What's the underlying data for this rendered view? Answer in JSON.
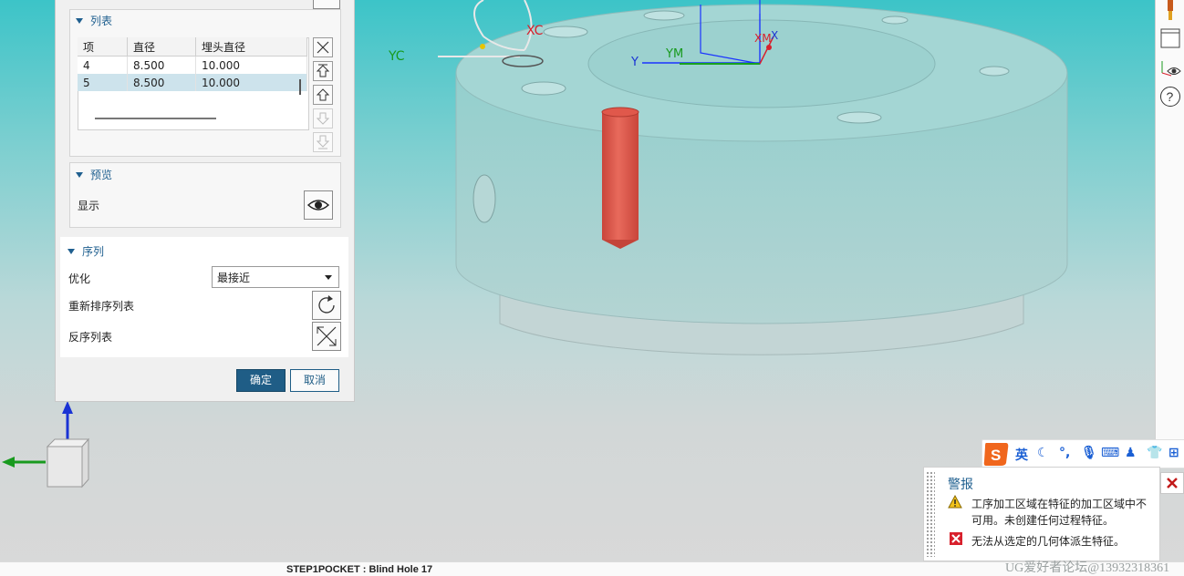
{
  "dialog": {
    "list_section": {
      "title": "列表",
      "columns": [
        "项",
        "直径",
        "埋头直径"
      ],
      "rows": [
        {
          "item": "4",
          "diameter": "8.500",
          "csink": "10.000"
        },
        {
          "item": "5",
          "diameter": "8.500",
          "csink": "10.000"
        }
      ],
      "selected_row_index": 1
    },
    "preview_section": {
      "title": "预览",
      "show_label": "显示"
    },
    "sequence_section": {
      "title": "序列",
      "optimize_label": "优化",
      "optimize_value": "最接近",
      "reorder_label": "重新排序列表",
      "reverse_label": "反序列表"
    },
    "ok_label": "确定",
    "cancel_label": "取消"
  },
  "viewport": {
    "triad_labels": {
      "yc": "YC",
      "xc": "XC",
      "ym": "YM",
      "y": "Y",
      "xm": "XM",
      "x": "X"
    },
    "colors": {
      "hole": "#e0584b",
      "part": "#9ed5d3",
      "bg_top": "#3cc4c8"
    }
  },
  "ime": {
    "lang_label": "英"
  },
  "alert": {
    "title": "警报",
    "items": [
      {
        "icon": "warning-icon",
        "text_line1": "工序加工区域在特征的加工区域中不",
        "text_line2": "可用。未创建任何过程特征。"
      },
      {
        "icon": "error-icon",
        "text_line1": "无法从选定的几何体派生特征。"
      }
    ]
  },
  "status": {
    "text": "STEP1POCKET : Blind Hole 17",
    "watermark": "UG爱好者论坛@13932318361"
  }
}
